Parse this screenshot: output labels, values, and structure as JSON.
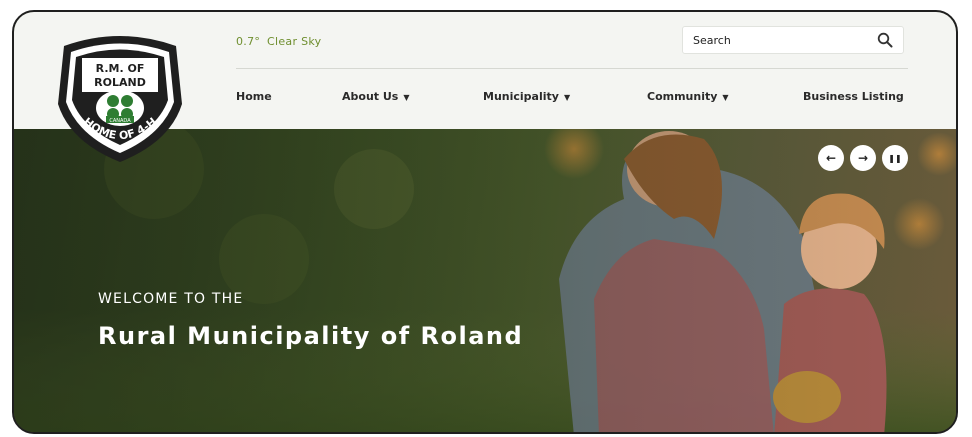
{
  "logo": {
    "top_text": "R.M. OF",
    "middle_text": "ROLAND",
    "badge_text": "CANADA",
    "bottom_text": "HOME OF 4-H"
  },
  "header": {
    "weather": {
      "temperature": "0.7°",
      "condition": "Clear Sky"
    },
    "search": {
      "placeholder": "Search",
      "value": ""
    }
  },
  "nav": [
    {
      "label": "Home",
      "has_dropdown": false
    },
    {
      "label": "About Us",
      "has_dropdown": true
    },
    {
      "label": "Municipality",
      "has_dropdown": true
    },
    {
      "label": "Community",
      "has_dropdown": true
    },
    {
      "label": "Business Listing",
      "has_dropdown": false
    }
  ],
  "hero": {
    "welcome": "WELCOME TO THE",
    "title": "Rural Municipality of Roland",
    "controls": [
      {
        "name": "previous",
        "icon": "arrow-left-icon",
        "glyph": "←"
      },
      {
        "name": "next",
        "icon": "arrow-right-icon",
        "glyph": "→"
      },
      {
        "name": "pause",
        "icon": "pause-icon",
        "glyph": "❚❚"
      }
    ]
  },
  "colors": {
    "accent_green": "#6f8f2f",
    "header_bg": "#f4f5f2",
    "logo_dark": "#1f1f1f",
    "logo_green": "#2e7d32"
  }
}
